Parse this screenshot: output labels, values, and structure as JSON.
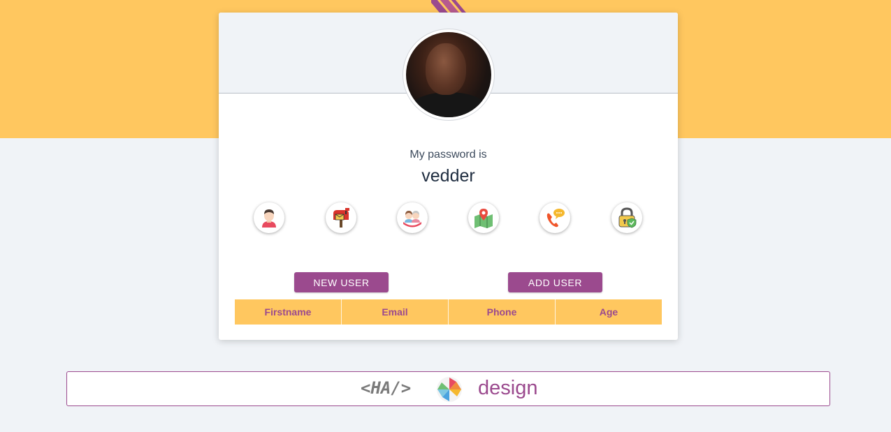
{
  "profile": {
    "password_label": "My password is",
    "password_value": "vedder"
  },
  "icons": [
    {
      "name": "user-icon"
    },
    {
      "name": "mailbox-icon"
    },
    {
      "name": "age-couple-icon"
    },
    {
      "name": "map-location-icon"
    },
    {
      "name": "phone-icon"
    },
    {
      "name": "lock-icon"
    }
  ],
  "actions": {
    "new_user_label": "NEW USER",
    "add_user_label": "ADD USER"
  },
  "table": {
    "headers": [
      "Firstname",
      "Email",
      "Phone",
      "Age"
    ]
  },
  "footer": {
    "code_text": "<HA/>",
    "brand_text": "design"
  },
  "colors": {
    "accent": "#9b4a8e",
    "band": "#ffc75f",
    "background": "#f0f3f7"
  }
}
